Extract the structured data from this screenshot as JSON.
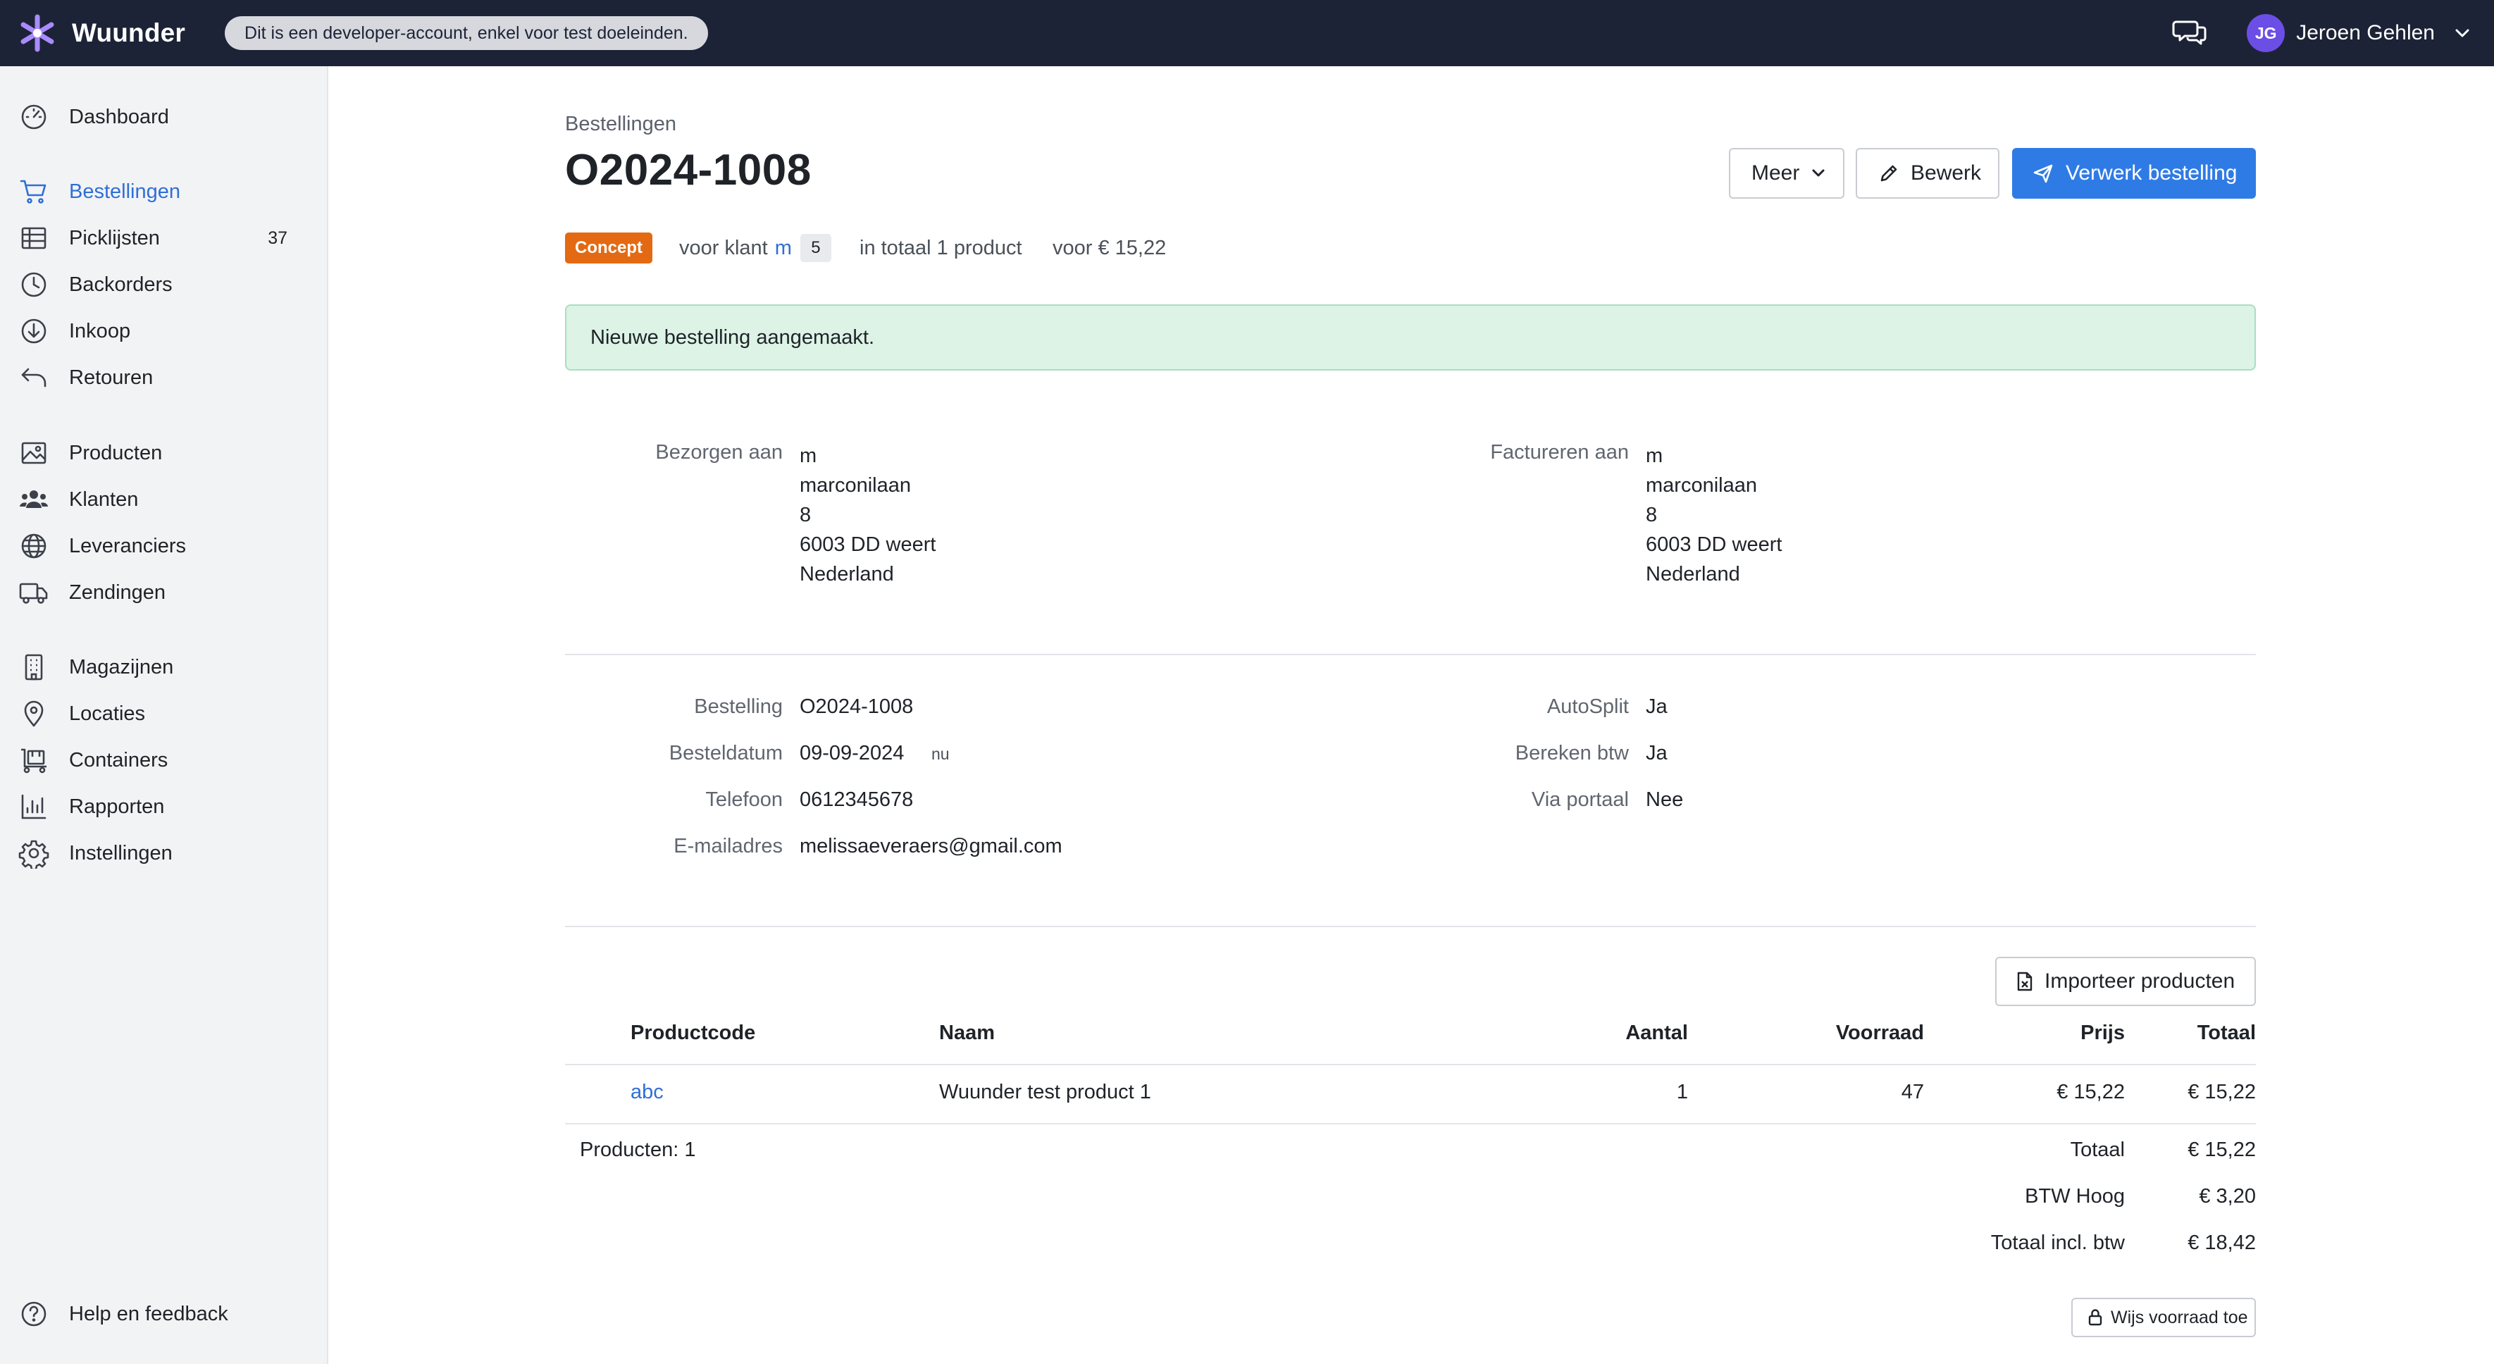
{
  "topbar": {
    "brand": "Wuunder",
    "dev_notice": "Dit is een developer-account, enkel voor test doeleinden.",
    "user_initials": "JG",
    "user_name": "Jeroen Gehlen"
  },
  "sidebar": {
    "items": [
      {
        "label": "Dashboard",
        "icon": "dashboard-icon"
      },
      {
        "label": "Bestellingen",
        "icon": "cart-icon",
        "active": true
      },
      {
        "label": "Picklijsten",
        "icon": "table-icon",
        "count": "37"
      },
      {
        "label": "Backorders",
        "icon": "clock-icon"
      },
      {
        "label": "Inkoop",
        "icon": "download-circle-icon"
      },
      {
        "label": "Retouren",
        "icon": "return-arrow-icon"
      },
      {
        "label": "Producten",
        "icon": "image-icon"
      },
      {
        "label": "Klanten",
        "icon": "users-icon"
      },
      {
        "label": "Leveranciers",
        "icon": "globe-icon"
      },
      {
        "label": "Zendingen",
        "icon": "truck-icon"
      },
      {
        "label": "Magazijnen",
        "icon": "building-icon"
      },
      {
        "label": "Locaties",
        "icon": "map-pin-icon"
      },
      {
        "label": "Containers",
        "icon": "container-icon"
      },
      {
        "label": "Rapporten",
        "icon": "bar-chart-icon"
      },
      {
        "label": "Instellingen",
        "icon": "gear-icon"
      }
    ],
    "help": {
      "label": "Help en feedback",
      "icon": "question-icon"
    }
  },
  "header": {
    "breadcrumb": "Bestellingen",
    "title": "O2024-1008",
    "buttons": {
      "more": "Meer",
      "edit": "Bewerk",
      "process": "Verwerk bestelling"
    }
  },
  "status": {
    "badge": "Concept",
    "customer_prefix": "voor klant",
    "customer_name": "m",
    "customer_count": "5",
    "products_text": "in totaal 1 product",
    "price_text": "voor € 15,22"
  },
  "alert": {
    "message": "Nieuwe bestelling aangemaakt."
  },
  "shipping": {
    "label": "Bezorgen aan",
    "lines": [
      "m",
      "marconilaan",
      "8",
      "6003 DD weert",
      "Nederland"
    ]
  },
  "billing": {
    "label": "Factureren aan",
    "lines": [
      "m",
      "marconilaan",
      "8",
      "6003 DD weert",
      "Nederland"
    ]
  },
  "details_left": {
    "order_label": "Bestelling",
    "order_value": "O2024-1008",
    "date_label": "Besteldatum",
    "date_value": "09-09-2024",
    "date_suffix": "nu",
    "phone_label": "Telefoon",
    "phone_value": "0612345678",
    "email_label": "E-mailadres",
    "email_value": "melissaeveraers@gmail.com"
  },
  "details_right": {
    "autosplit_label": "AutoSplit",
    "autosplit_value": "Ja",
    "vat_label": "Bereken btw",
    "vat_value": "Ja",
    "portal_label": "Via portaal",
    "portal_value": "Nee"
  },
  "products": {
    "import_button": "Importeer producten",
    "columns": {
      "code": "Productcode",
      "name": "Naam",
      "qty": "Aantal",
      "stock": "Voorraad",
      "price": "Prijs",
      "total": "Totaal"
    },
    "rows": [
      {
        "code": "abc",
        "name": "Wuunder test product 1",
        "qty": "1",
        "stock": "47",
        "price": "€ 15,22",
        "total": "€ 15,22"
      }
    ],
    "count_text": "Producten: 1",
    "summary": {
      "total_label": "Totaal",
      "total_value": "€ 15,22",
      "vat_label": "BTW Hoog",
      "vat_value": "€ 3,20",
      "grand_label": "Totaal incl. btw",
      "grand_value": "€ 18,42"
    },
    "stock_button": "Wijs voorraad toe"
  },
  "colors": {
    "topbar": "#1c2336",
    "accent": "#2f7be5",
    "link": "#2f6fd6",
    "badge": "#e36a12",
    "alert_bg": "#dcf3e6"
  }
}
